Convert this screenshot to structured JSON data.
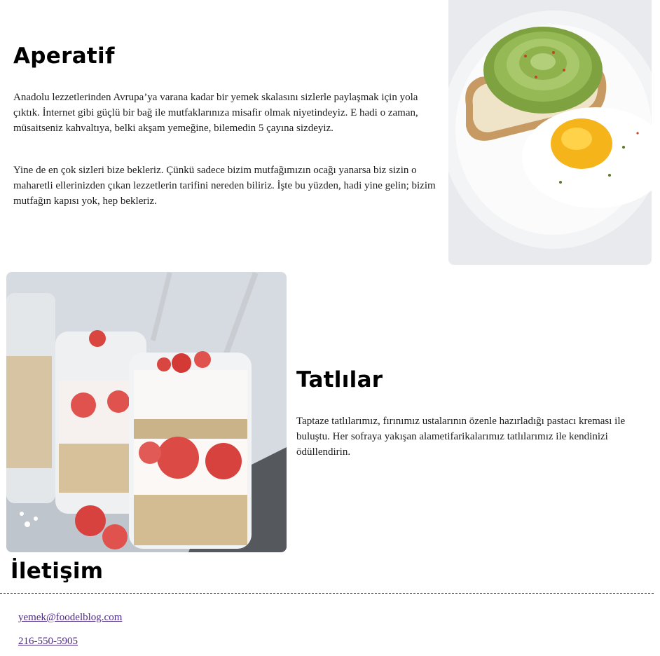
{
  "appetizer": {
    "title": "Aperatif",
    "paragraph1": "Anadolu lezzetlerinden Avrupa’ya varana kadar bir yemek skalasını sizlerle paylaşmak için yola çıktık. İnternet gibi güçlü bir bağ ile mutfaklarınıza misafir olmak niyetindeyiz. E hadi o zaman, müsaitseniz kahvaltıya, belki akşam yemeğine, bilemedin 5 çayına sizdeyiz.",
    "paragraph2": "Yine de en çok sizleri bize bekleriz. Çünkü sadece bizim mutfağımızın ocağı yanarsa biz sizin o maharetli ellerinizden çıkan lezzetlerin tarifini nereden biliriz. İşte bu yüzden, hadi yine gelin; bizim mutfağın kapısı yok, hep bekleriz."
  },
  "desserts": {
    "title": "Tatlılar",
    "paragraph": "Taptaze tatlılarımız, fırınımız ustalarının özenle hazırladığı pastacı kreması ile buluştu. Her sofraya yakışan alametifarikalarımız tatlılarımız ile kendinizi ödüllendirin."
  },
  "contact": {
    "title": "İletişim",
    "email": "yemek@foodelblog.com",
    "phone": "216-550-5905"
  },
  "colors": {
    "link": "#4b2a83",
    "text": "#1c1c1c"
  }
}
